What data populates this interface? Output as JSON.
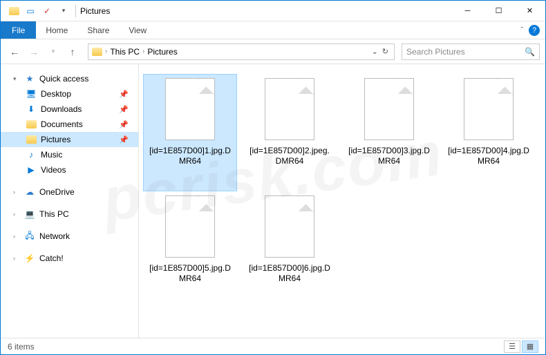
{
  "title": "Pictures",
  "ribbon": {
    "file": "File",
    "tabs": [
      "Home",
      "Share",
      "View"
    ]
  },
  "breadcrumb": {
    "items": [
      "This PC",
      "Pictures"
    ]
  },
  "search": {
    "placeholder": "Search Pictures"
  },
  "sidebar": {
    "quick_access": "Quick access",
    "quick_items": [
      {
        "label": "Desktop",
        "pinned": true
      },
      {
        "label": "Downloads",
        "pinned": true
      },
      {
        "label": "Documents",
        "pinned": true
      },
      {
        "label": "Pictures",
        "pinned": true,
        "selected": true
      },
      {
        "label": "Music",
        "pinned": false
      },
      {
        "label": "Videos",
        "pinned": false
      }
    ],
    "onedrive": "OneDrive",
    "this_pc": "This PC",
    "network": "Network",
    "catch": "Catch!"
  },
  "files": [
    {
      "name": "[id=1E857D00]1.jpg.DMR64",
      "selected": true
    },
    {
      "name": "[id=1E857D00]2.jpeg.DMR64",
      "selected": false
    },
    {
      "name": "[id=1E857D00]3.jpg.DMR64",
      "selected": false
    },
    {
      "name": "[id=1E857D00]4.jpg.DMR64",
      "selected": false
    },
    {
      "name": "[id=1E857D00]5.jpg.DMR64",
      "selected": false
    },
    {
      "name": "[id=1E857D00]6.jpg.DMR64",
      "selected": false
    }
  ],
  "status": {
    "count": "6 items"
  },
  "watermark": "pcrisk.com"
}
